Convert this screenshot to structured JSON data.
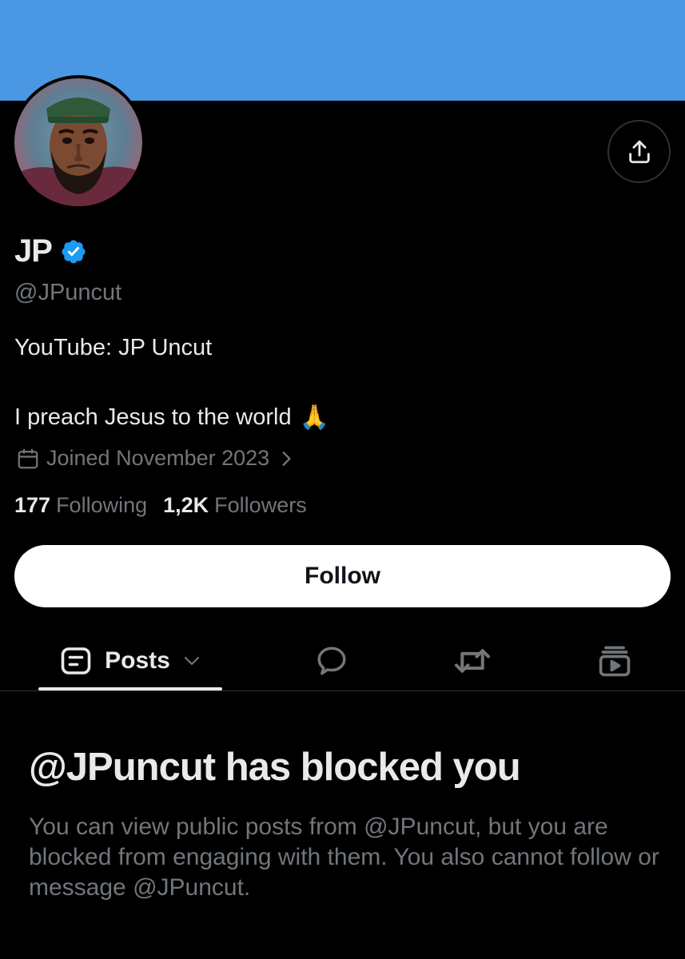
{
  "profile": {
    "display_name": "JP",
    "handle": "@JPuncut",
    "bio_line1": "YouTube: JP Uncut",
    "bio_line2": "I preach Jesus to the world",
    "bio_emoji": "🙏",
    "joined": "Joined November 2023",
    "following_count": "177",
    "following_label": "Following",
    "followers_count": "1,2K",
    "followers_label": "Followers",
    "verified": true
  },
  "actions": {
    "follow_label": "Follow",
    "share_icon": "share-icon"
  },
  "tabs": [
    {
      "label": "Posts",
      "icon": "posts-icon",
      "selected": true
    },
    {
      "label": "",
      "icon": "replies-icon"
    },
    {
      "label": "",
      "icon": "reposts-icon"
    },
    {
      "label": "",
      "icon": "media-icon"
    }
  ],
  "blocked": {
    "title": "@JPuncut has blocked you",
    "description": "You can view public posts from @JPuncut, but you are blocked from engaging with them. You also cannot follow or message @JPuncut."
  },
  "colors": {
    "banner": "#4a98e3",
    "background": "#000000",
    "text_primary": "#e7e9ea",
    "text_secondary": "#71767b",
    "verified_badge": "#1d9bf0"
  }
}
